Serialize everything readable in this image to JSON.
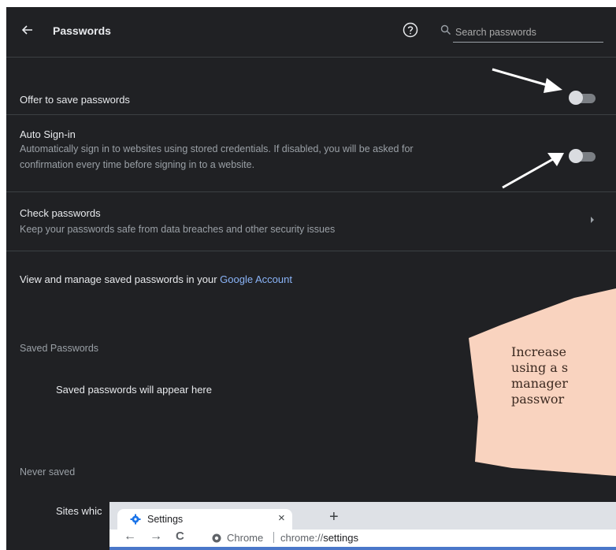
{
  "header": {
    "title": "Passwords",
    "search_placeholder": "Search passwords"
  },
  "settings": {
    "offer_save": {
      "label": "Offer to save passwords",
      "enabled": false
    },
    "auto_signin": {
      "label": "Auto Sign-in",
      "desc_line1": "Automatically sign in to websites using stored credentials. If disabled, you will be asked for",
      "desc_line2": "confirmation every time before signing in to a website.",
      "enabled": false
    },
    "check_passwords": {
      "label": "Check passwords",
      "desc": "Keep your passwords safe from data breaches and other security issues"
    },
    "google_account": {
      "prefix": "View and manage saved passwords in your ",
      "link": "Google Account"
    }
  },
  "saved": {
    "heading": "Saved Passwords",
    "empty": "Saved passwords will appear here"
  },
  "never": {
    "heading": "Never saved",
    "text": "Sites whic"
  },
  "callout": {
    "lines": [
      "Increase",
      "using a s",
      "manager",
      "passwor"
    ],
    "color": "#f9d3bf"
  },
  "chrome": {
    "tab_title": "Settings",
    "tab_close": "×",
    "new_tab": "+",
    "back": "←",
    "forward": "→",
    "reload": "C",
    "omni_label": "Chrome",
    "url_scheme": "chrome://",
    "url_path": "settings"
  },
  "colors": {
    "bg": "#202124",
    "accent": "#8ab4f8",
    "toggle_off": "#7b7f84"
  },
  "icons": [
    "back-arrow-icon",
    "help-icon",
    "search-icon",
    "chevron-right-icon",
    "gear-icon",
    "chrome-logo-icon"
  ]
}
